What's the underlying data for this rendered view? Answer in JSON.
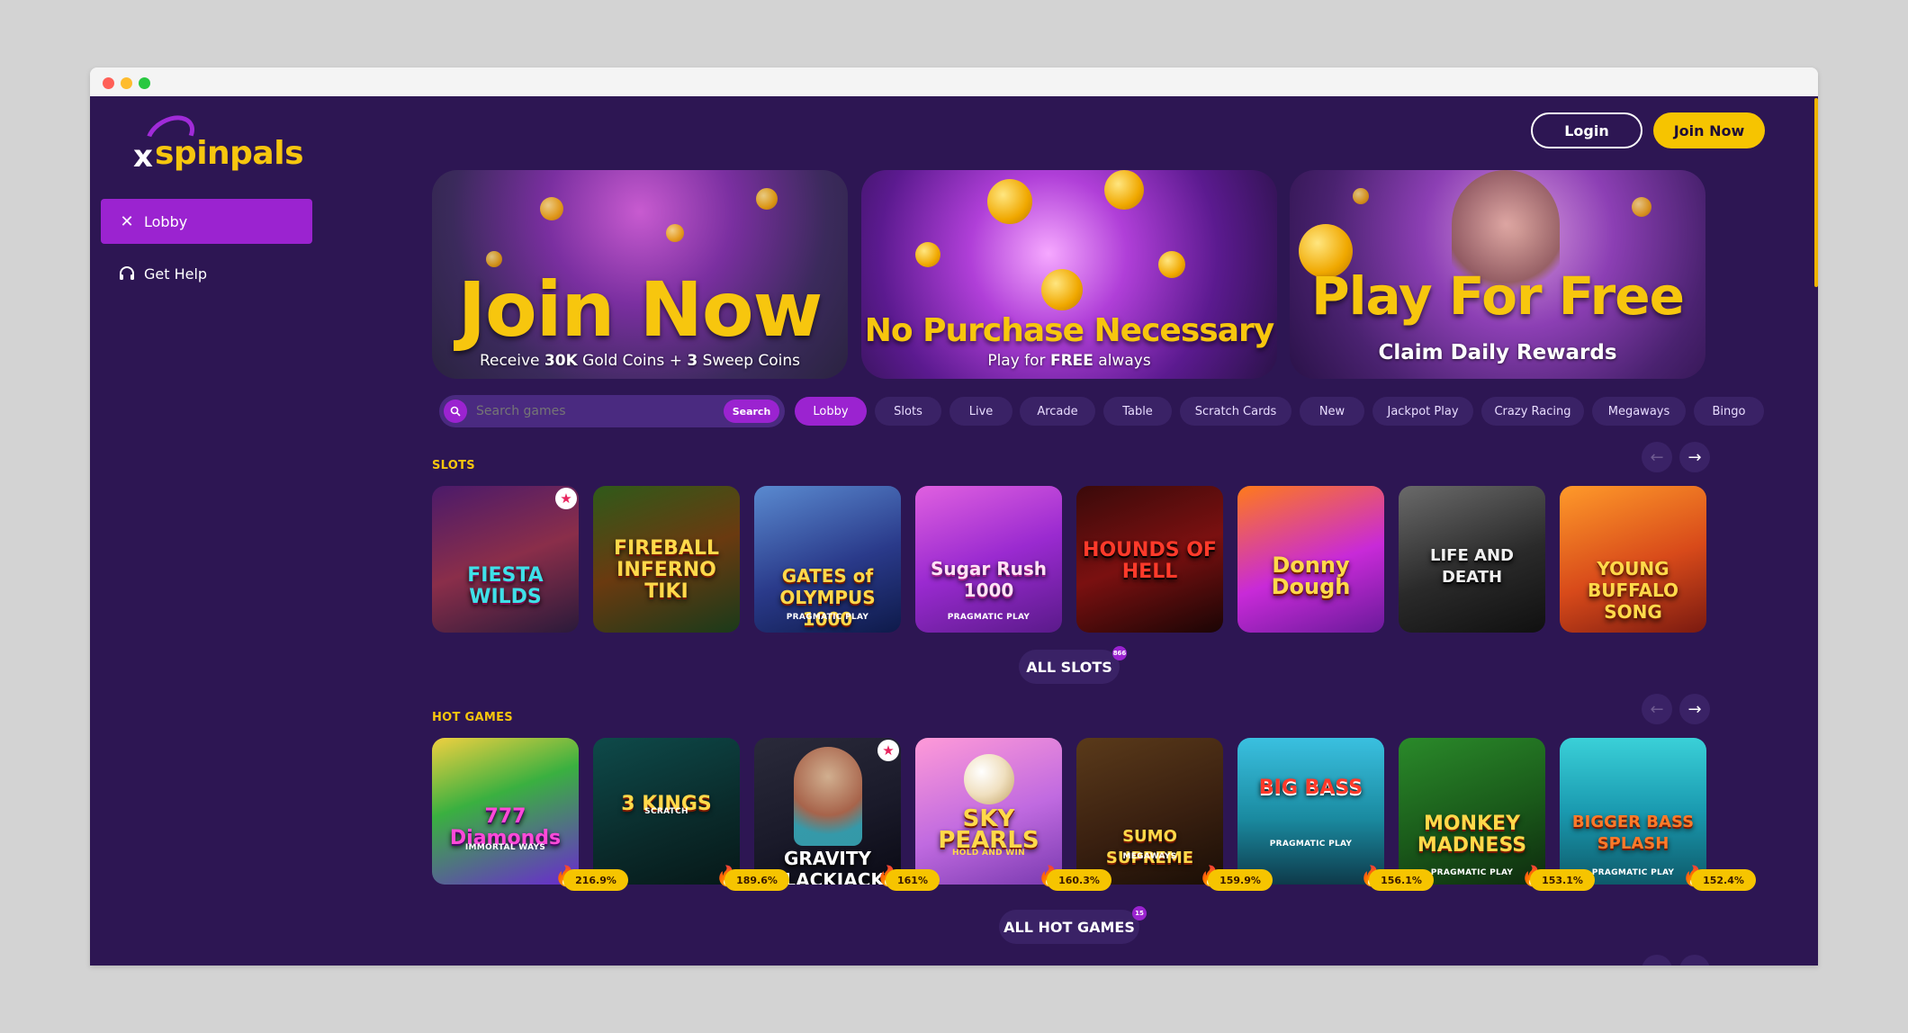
{
  "brand": {
    "name": "spinpals",
    "mark": "x"
  },
  "sidebar": {
    "items": [
      {
        "label": "Lobby",
        "icon": "x-logo-icon",
        "active": true
      },
      {
        "label": "Get Help",
        "icon": "headset-icon",
        "active": false
      }
    ]
  },
  "header": {
    "login_label": "Login",
    "join_label": "Join Now"
  },
  "banners": [
    {
      "title": "Join Now",
      "sub_pre": "Receive ",
      "sub_b1": "30K",
      "sub_mid": " Gold Coins + ",
      "sub_b2": "3",
      "sub_post": " Sweep Coins"
    },
    {
      "title": "No Purchase Necessary",
      "sub_pre": "Play for ",
      "sub_b1": "FREE",
      "sub_post": " always"
    },
    {
      "title": "Play For Free",
      "sub": "Claim Daily Rewards"
    }
  ],
  "search": {
    "placeholder": "Search games",
    "button_label": "Search"
  },
  "tabs": [
    "Lobby",
    "Slots",
    "Live",
    "Arcade",
    "Table",
    "Scratch Cards",
    "New",
    "Jackpot Play",
    "Crazy Racing",
    "Megaways",
    "Bingo"
  ],
  "slots": {
    "title": "SLOTS",
    "games": [
      {
        "name": "FIESTA WILDS",
        "sub": "",
        "badge": "★"
      },
      {
        "name": "FIREBALL INFERNO TIKI",
        "sub": ""
      },
      {
        "name": "GATES of OLYMPUS 1000",
        "sub": "PRAGMATIC PLAY"
      },
      {
        "name": "Sugar Rush 1000",
        "sub": "PRAGMATIC PLAY"
      },
      {
        "name": "HOUNDS OF HELL",
        "sub": ""
      },
      {
        "name": "Donny Dough",
        "sub": ""
      },
      {
        "name": "LIFE AND DEATH",
        "sub": ""
      },
      {
        "name": "YOUNG BUFFALO SONG",
        "sub": ""
      }
    ],
    "all_label": "ALL SLOTS",
    "count": "866"
  },
  "hot": {
    "title": "HOT GAMES",
    "games": [
      {
        "name": "777 Diamonds",
        "sub": "IMMORTAL WAYS",
        "heat": "216.9%"
      },
      {
        "name": "3 KINGS",
        "sub": "SCRATCH",
        "heat": "189.6%"
      },
      {
        "name": "GRAVITY BLACKJACK",
        "sub": "",
        "heat": "161%",
        "badge": "★"
      },
      {
        "name": "SKY PEARLS",
        "sub": "HOLD AND WIN",
        "heat": "160.3%"
      },
      {
        "name": "SUMO SUPREME",
        "sub": "MEGAWAYS",
        "heat": "159.9%"
      },
      {
        "name": "BIG BASS",
        "sub": "PRAGMATIC PLAY",
        "heat": "156.1%"
      },
      {
        "name": "MONKEY MADNESS",
        "sub": "PRAGMATIC PLAY",
        "heat": "153.1%"
      },
      {
        "name": "BIGGER BASS SPLASH",
        "sub": "PRAGMATIC PLAY",
        "heat": "152.4%"
      }
    ],
    "all_label": "ALL HOT GAMES",
    "count": "15"
  },
  "colors": {
    "bg": "#2d1653",
    "accent": "#9b23d0",
    "gold": "#f6c400"
  }
}
